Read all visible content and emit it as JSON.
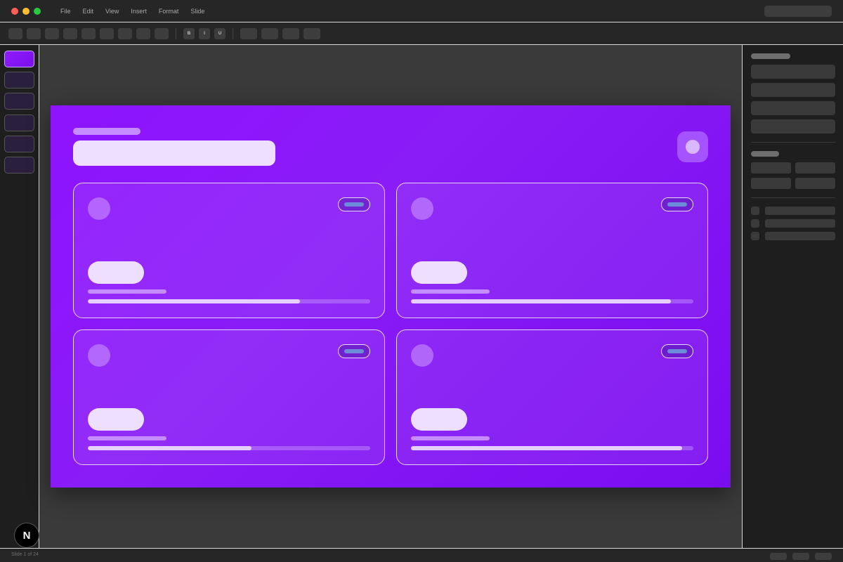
{
  "menubar": {
    "items": [
      "File",
      "Edit",
      "View",
      "Insert",
      "Format",
      "Slide"
    ]
  },
  "toolbar": {
    "bold_label": "B",
    "italic_label": "I",
    "underline_label": "U"
  },
  "statusbar": {
    "slide_indicator": "Slide 1 of 24"
  },
  "app_badge": {
    "label": "N"
  },
  "slide": {
    "cards": [
      {
        "progress": 0.75
      },
      {
        "progress": 0.92
      },
      {
        "progress": 0.58
      },
      {
        "progress": 0.96
      }
    ]
  },
  "colors": {
    "accent": "#8e13ff",
    "canvas_bg": "#3a3a3a",
    "chrome_bg": "#262626"
  }
}
